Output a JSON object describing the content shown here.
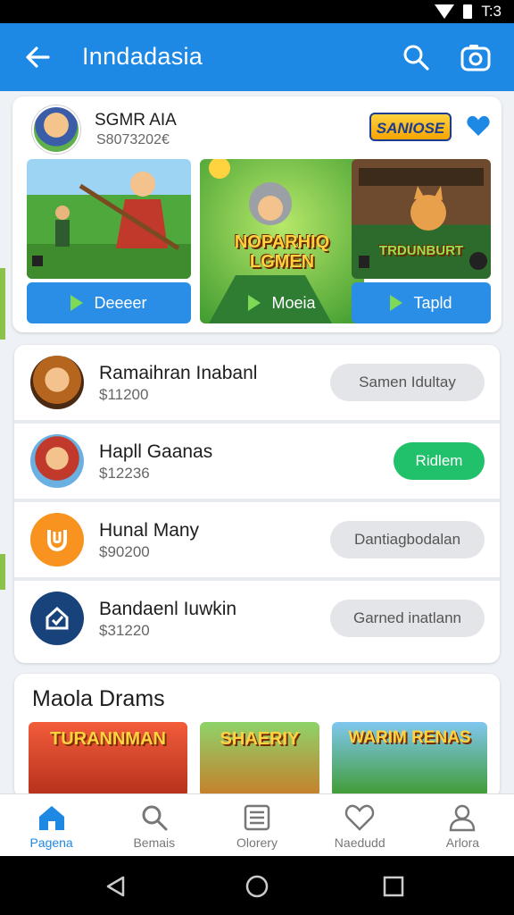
{
  "status": {
    "time": "T:3"
  },
  "appbar": {
    "title": "Inndadasia"
  },
  "featured": {
    "user_name": "SGMR AIA",
    "user_sub": "S8073202€",
    "logo_text": "SANIOSE",
    "tiles": [
      {
        "button": "Deeeer",
        "art_title": ""
      },
      {
        "button": "Moeia",
        "art_title": "NOPARHIQ LGMEN"
      },
      {
        "button": "Tapld",
        "art_title": "TRDUNBURT"
      }
    ]
  },
  "list": [
    {
      "name": "Ramaihran Inabanl",
      "price": "$11200",
      "action": "Samen Idultay",
      "action_style": "gray"
    },
    {
      "name": "Hapll Gaanas",
      "price": "$12236",
      "action": "Ridlem",
      "action_style": "green"
    },
    {
      "name": "Hunal Many",
      "price": "$90200",
      "action": "Dantiagbodalan",
      "action_style": "gray"
    },
    {
      "name": "Bandaenl Iuwkin",
      "price": "$31220",
      "action": "Garned inatlann",
      "action_style": "gray"
    }
  ],
  "more": {
    "title": "Maola Drams",
    "tiles": [
      "TURANNMAN",
      "SHAERIY",
      "WARIM RENAS"
    ]
  },
  "bottom_nav": [
    {
      "label": "Pagena",
      "icon": "home-icon",
      "active": true
    },
    {
      "label": "Bemais",
      "icon": "search-icon",
      "active": false
    },
    {
      "label": "Olorery",
      "icon": "list-icon",
      "active": false
    },
    {
      "label": "Naedudd",
      "icon": "heart-icon",
      "active": false
    },
    {
      "label": "Arlora",
      "icon": "profile-icon",
      "active": false
    }
  ],
  "colors": {
    "primary": "#1e88e5",
    "accent_green": "#21c16b"
  }
}
